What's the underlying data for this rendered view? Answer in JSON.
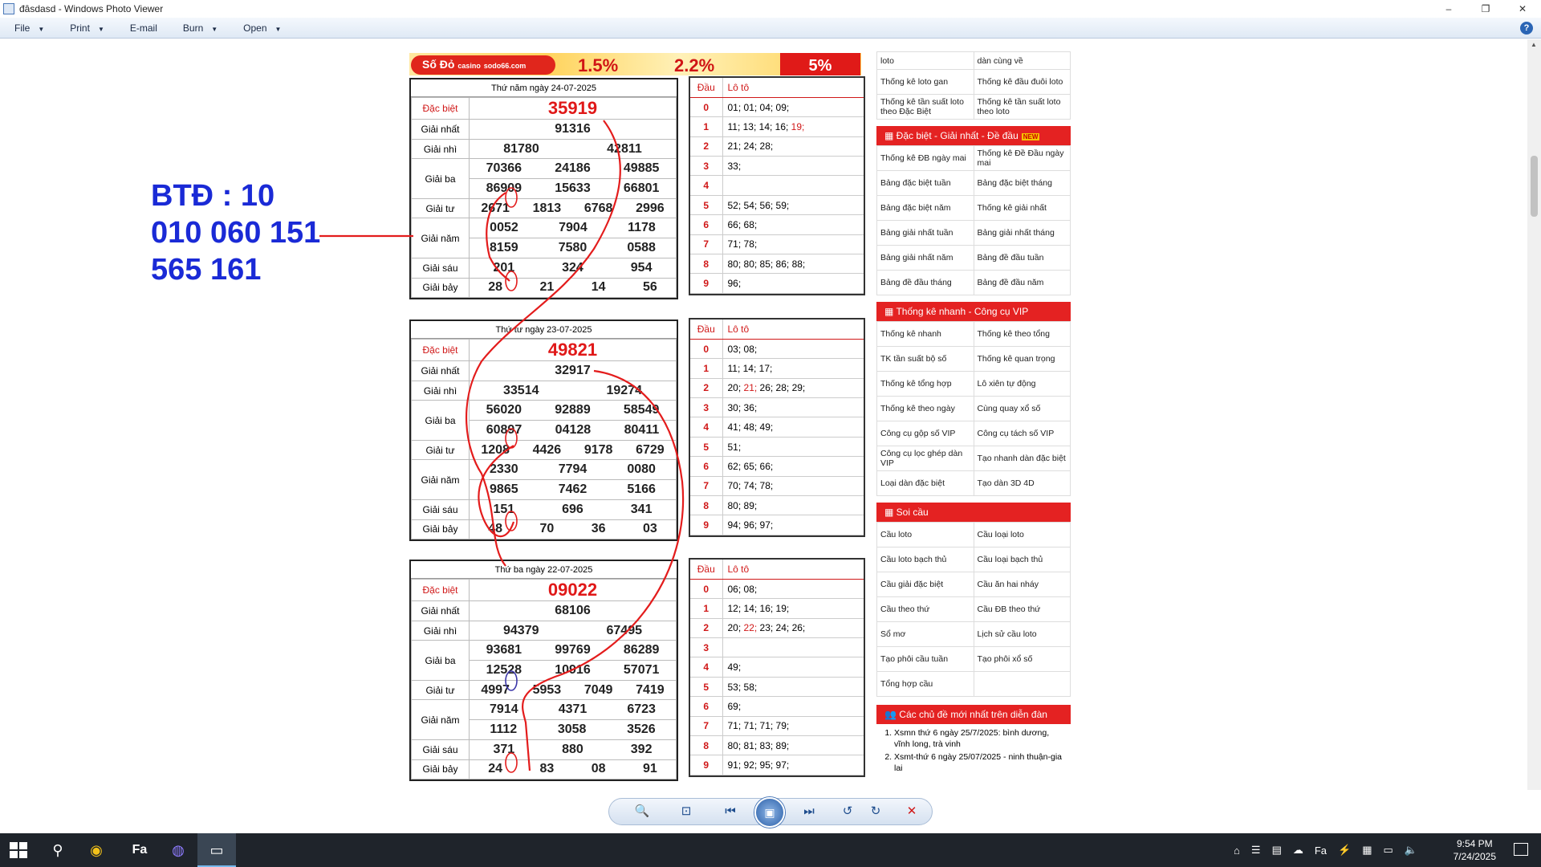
{
  "window": {
    "title": "đâsdasd - Windows Photo Viewer",
    "min": "–",
    "max": "❐",
    "close": "✕"
  },
  "menu": [
    {
      "label": "File",
      "arrow": "▼"
    },
    {
      "label": "Print",
      "arrow": "▼"
    },
    {
      "label": "E-mail",
      "arrow": ""
    },
    {
      "label": "Burn",
      "arrow": "▼"
    },
    {
      "label": "Open",
      "arrow": "▼"
    }
  ],
  "annotation": {
    "line1": "BTĐ : 10",
    "line2": "010 060 151",
    "line3": "565 161"
  },
  "banner": {
    "logo": "Số Đỏ",
    "logo_sub": "casino",
    "site": "sodo66.com",
    "p1": "1.5%",
    "p2": "2.2%",
    "p3": "5%"
  },
  "results": [
    {
      "date": "Thứ năm ngày 24-07-2025",
      "rows": [
        {
          "label": "Đặc biệt",
          "nums": [
            "35919"
          ]
        },
        {
          "label": "Giải nhất",
          "nums": [
            "91316"
          ]
        },
        {
          "label": "Giải nhì",
          "nums": [
            "81780",
            "42811"
          ]
        },
        {
          "label": "Giải ba",
          "nums": [
            "70366",
            "24186",
            "49885"
          ]
        },
        {
          "label": "",
          "nums": [
            "86909",
            "15633",
            "66801"
          ]
        },
        {
          "label": "Giải tư",
          "nums": [
            "2671",
            "1813",
            "6768",
            "2996"
          ]
        },
        {
          "label": "Giải năm",
          "nums": [
            "0052",
            "7904",
            "1178"
          ]
        },
        {
          "label": "",
          "nums": [
            "8159",
            "7580",
            "0588"
          ]
        },
        {
          "label": "Giải sáu",
          "nums": [
            "201",
            "324",
            "954"
          ]
        },
        {
          "label": "Giải bảy",
          "nums": [
            "28",
            "21",
            "14",
            "56"
          ]
        }
      ]
    },
    {
      "date": "Thứ tư ngày 23-07-2025",
      "rows": [
        {
          "label": "Đặc biệt",
          "nums": [
            "49821"
          ]
        },
        {
          "label": "Giải nhất",
          "nums": [
            "32917"
          ]
        },
        {
          "label": "Giải nhì",
          "nums": [
            "33514",
            "19274"
          ]
        },
        {
          "label": "Giải ba",
          "nums": [
            "56020",
            "92889",
            "58549"
          ]
        },
        {
          "label": "",
          "nums": [
            "60897",
            "04128",
            "80411"
          ]
        },
        {
          "label": "Giải tư",
          "nums": [
            "1208",
            "4426",
            "9178",
            "6729"
          ]
        },
        {
          "label": "Giải năm",
          "nums": [
            "2330",
            "7794",
            "0080"
          ]
        },
        {
          "label": "",
          "nums": [
            "9865",
            "7462",
            "5166"
          ]
        },
        {
          "label": "Giải sáu",
          "nums": [
            "151",
            "696",
            "341"
          ]
        },
        {
          "label": "Giải bảy",
          "nums": [
            "48",
            "70",
            "36",
            "03"
          ]
        }
      ]
    },
    {
      "date": "Thứ ba ngày 22-07-2025",
      "rows": [
        {
          "label": "Đặc biệt",
          "nums": [
            "09022"
          ]
        },
        {
          "label": "Giải nhất",
          "nums": [
            "68106"
          ]
        },
        {
          "label": "Giải nhì",
          "nums": [
            "94379",
            "67495"
          ]
        },
        {
          "label": "Giải ba",
          "nums": [
            "93681",
            "99769",
            "86289"
          ]
        },
        {
          "label": "",
          "nums": [
            "12528",
            "10916",
            "57071"
          ]
        },
        {
          "label": "Giải tư",
          "nums": [
            "4997",
            "5953",
            "7049",
            "7419"
          ]
        },
        {
          "label": "Giải năm",
          "nums": [
            "7914",
            "4371",
            "6723"
          ]
        },
        {
          "label": "",
          "nums": [
            "1112",
            "3058",
            "3526"
          ]
        },
        {
          "label": "Giải sáu",
          "nums": [
            "371",
            "880",
            "392"
          ]
        },
        {
          "label": "Giải bảy",
          "nums": [
            "24",
            "83",
            "08",
            "91"
          ]
        }
      ]
    }
  ],
  "loto_header": {
    "dau": "Đầu",
    "loto": "Lô tô"
  },
  "loto": [
    [
      {
        "d": "0",
        "v": "01; 01; 04; 09;",
        "hl": ""
      },
      {
        "d": "1",
        "v": "11; 13; 14; 16; ",
        "hl": "19;"
      },
      {
        "d": "2",
        "v": "21; 24; 28;",
        "hl": ""
      },
      {
        "d": "3",
        "v": "33;",
        "hl": ""
      },
      {
        "d": "4",
        "v": "",
        "hl": ""
      },
      {
        "d": "5",
        "v": "52; 54; 56; 59;",
        "hl": ""
      },
      {
        "d": "6",
        "v": "66; 68;",
        "hl": ""
      },
      {
        "d": "7",
        "v": "71; 78;",
        "hl": ""
      },
      {
        "d": "8",
        "v": "80; 80; 85; 86; 88;",
        "hl": ""
      },
      {
        "d": "9",
        "v": "96;",
        "hl": ""
      }
    ],
    [
      {
        "d": "0",
        "v": "03; 08;",
        "hl": ""
      },
      {
        "d": "1",
        "v": "11; 14; 17;",
        "hl": ""
      },
      {
        "d": "2",
        "v": "20; ",
        "hl": "21;",
        "v2": " 26; 28; 29;"
      },
      {
        "d": "3",
        "v": "30; 36;",
        "hl": ""
      },
      {
        "d": "4",
        "v": "41; 48; 49;",
        "hl": ""
      },
      {
        "d": "5",
        "v": "51;",
        "hl": ""
      },
      {
        "d": "6",
        "v": "62; 65; 66;",
        "hl": ""
      },
      {
        "d": "7",
        "v": "70; 74; 78;",
        "hl": ""
      },
      {
        "d": "8",
        "v": "80; 89;",
        "hl": ""
      },
      {
        "d": "9",
        "v": "94; 96; 97;",
        "hl": ""
      }
    ],
    [
      {
        "d": "0",
        "v": "06; 08;",
        "hl": ""
      },
      {
        "d": "1",
        "v": "12; 14; 16; 19;",
        "hl": ""
      },
      {
        "d": "2",
        "v": "20; ",
        "hl": "22;",
        "v2": " 23; 24; 26;"
      },
      {
        "d": "3",
        "v": "",
        "hl": ""
      },
      {
        "d": "4",
        "v": "49;",
        "hl": ""
      },
      {
        "d": "5",
        "v": "53; 58;",
        "hl": ""
      },
      {
        "d": "6",
        "v": "69;",
        "hl": ""
      },
      {
        "d": "7",
        "v": "71; 71; 71; 79;",
        "hl": ""
      },
      {
        "d": "8",
        "v": "80; 81; 83; 89;",
        "hl": ""
      },
      {
        "d": "9",
        "v": "91; 92; 95; 97;",
        "hl": ""
      }
    ]
  ],
  "sidebar": {
    "top_rows": [
      [
        "loto",
        "dàn cùng về"
      ],
      [
        "Thống kê loto gan",
        "Thống kê đầu đuôi loto"
      ],
      [
        "Thống kê tần suất loto theo Đặc Biệt",
        "Thống kê tần suất loto theo loto"
      ]
    ],
    "sections": [
      {
        "title": "Đặc biệt - Giải nhất - Đề đầu",
        "badge": "NEW",
        "rows": [
          [
            "Thống kê ĐB ngày mai",
            "Thống kê Đề Đầu ngày mai"
          ],
          [
            "Bảng đặc biệt tuần",
            "Bảng đặc biệt tháng"
          ],
          [
            "Bảng đặc biệt năm",
            "Thống kê giải nhất"
          ],
          [
            "Bảng giải nhất tuần",
            "Bảng giải nhất tháng"
          ],
          [
            "Bảng giải nhất năm",
            "Bảng đề đầu tuần"
          ],
          [
            "Bảng đề đầu tháng",
            "Bảng đề đầu năm"
          ]
        ]
      },
      {
        "title": "Thống kê nhanh - Công cụ VIP",
        "badge": "",
        "rows": [
          [
            "Thống kê nhanh",
            "Thống kê theo tổng"
          ],
          [
            "TK tần suất bộ số",
            "Thống kê quan trọng"
          ],
          [
            "Thống kê tổng hợp",
            "Lô xiên tự động"
          ],
          [
            "Thống kê theo ngày",
            "Cùng quay xổ số"
          ],
          [
            "Công cụ gộp số VIP",
            "Công cụ tách số VIP"
          ],
          [
            "Công cụ lọc ghép dàn VIP",
            "Tạo nhanh dàn đặc biệt"
          ],
          [
            "Loại dàn đặc biệt",
            "Tạo dàn 3D 4D"
          ]
        ]
      },
      {
        "title": "Soi cầu",
        "badge": "",
        "rows": [
          [
            "Cầu loto",
            "Cầu loại loto"
          ],
          [
            "Cầu loto bạch thủ",
            "Cầu loại bạch thủ"
          ],
          [
            "Cầu giải đặc biệt",
            "Cầu ăn hai nháy"
          ],
          [
            "Cầu theo thứ",
            "Cầu ĐB theo thứ"
          ],
          [
            "Sổ mơ",
            "Lịch sử cầu loto"
          ],
          [
            "Tạo phôi cầu tuần",
            "Tạo phôi xổ số"
          ],
          [
            "Tổng hợp cầu",
            ""
          ]
        ]
      }
    ],
    "forum": {
      "title": "Các chủ đề mới nhất trên diễn đàn",
      "items": [
        "Xsmn thứ 6 ngày 25/7/2025: bình dương, vĩnh long, trà vinh",
        "Xsmt-thứ 6 ngày 25/07/2025 - ninh thuận-gia lai"
      ]
    }
  },
  "toolbar": {
    "zoom": "🔍",
    "fit": "⊡",
    "prev": "⏮",
    "slideshow": "▣",
    "next": "⏭",
    "rotl": "↺",
    "rotr": "↻",
    "delete": "✕"
  },
  "taskbar": {
    "time": "9:54 PM",
    "date": "7/24/2025",
    "fa": "Fa"
  },
  "colors": {
    "accent_red": "#e42222",
    "annotation_blue": "#1a2ad6"
  }
}
